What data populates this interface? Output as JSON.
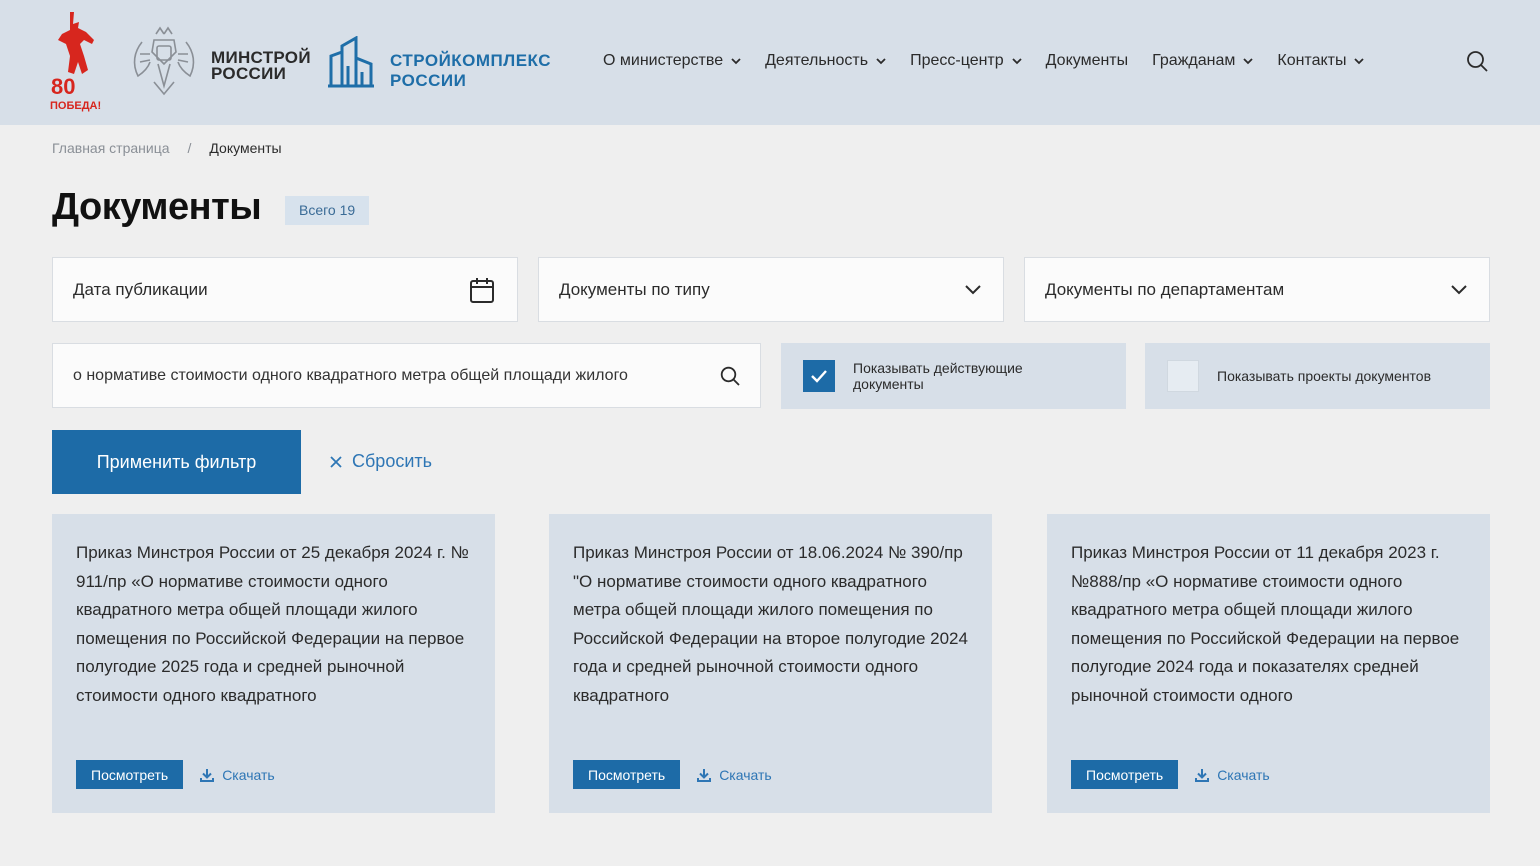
{
  "header": {
    "victory_logo_text": "80 ПОБЕДА!",
    "ministry_name_line1": "МИНСТРОЙ",
    "ministry_name_line2": "РОССИИ",
    "stroy_name_line1": "СТРОЙКОМПЛЕКС",
    "stroy_name_line2": "РОССИИ",
    "nav": [
      {
        "label": "О министерстве",
        "has_dropdown": true
      },
      {
        "label": "Деятельность",
        "has_dropdown": true
      },
      {
        "label": "Пресс-центр",
        "has_dropdown": true
      },
      {
        "label": "Документы",
        "has_dropdown": false
      },
      {
        "label": "Гражданам",
        "has_dropdown": true
      },
      {
        "label": "Контакты",
        "has_dropdown": true
      }
    ]
  },
  "breadcrumb": {
    "home": "Главная страница",
    "separator": "/",
    "current": "Документы"
  },
  "page": {
    "title": "Документы",
    "count_label": "Всего 19"
  },
  "filters": {
    "date_label": "Дата публикации",
    "type_label": "Документы по типу",
    "department_label": "Документы по департаментам",
    "search_value": "о нормативе стоимости одного квадратного метра общей площади жилого",
    "show_active_label": "Показывать действующие документы",
    "show_active_checked": true,
    "show_projects_label": "Показывать проекты документов",
    "show_projects_checked": false,
    "apply_label": "Применить фильтр",
    "reset_label": "Сбросить"
  },
  "documents": [
    {
      "text": "Приказ Минстроя России от 25 декабря 2024 г. № 911/пр «О нормативе стоимости одного квадратного метра общей площади жилого помещения по Российской Федерации на первое полугодие 2025 года и средней рыночной стоимости одного квадратного",
      "view_label": "Посмотреть",
      "download_label": "Скачать"
    },
    {
      "text": "Приказ Минстроя России от 18.06.2024 № 390/пр \"О нормативе стоимости одного квадратного метра общей площади жилого помещения по Российской Федерации на второе полугодие 2024 года и средней рыночной стоимости одного квадратного",
      "view_label": "Посмотреть",
      "download_label": "Скачать"
    },
    {
      "text": "Приказ Минстроя России от 11 декабря 2023 г. №888/пр «О нормативе стоимости одного квадратного метра общей площади жилого помещения по Российской Федерации на первое полугодие 2024 года и показателях средней рыночной стоимости одного",
      "view_label": "Посмотреть",
      "download_label": "Скачать"
    }
  ],
  "colors": {
    "header_bg": "#d7dfe8",
    "page_bg": "#efefef",
    "primary_blue": "#1d6ba7",
    "link_blue": "#2e76b5",
    "victory_red": "#d7261e"
  }
}
